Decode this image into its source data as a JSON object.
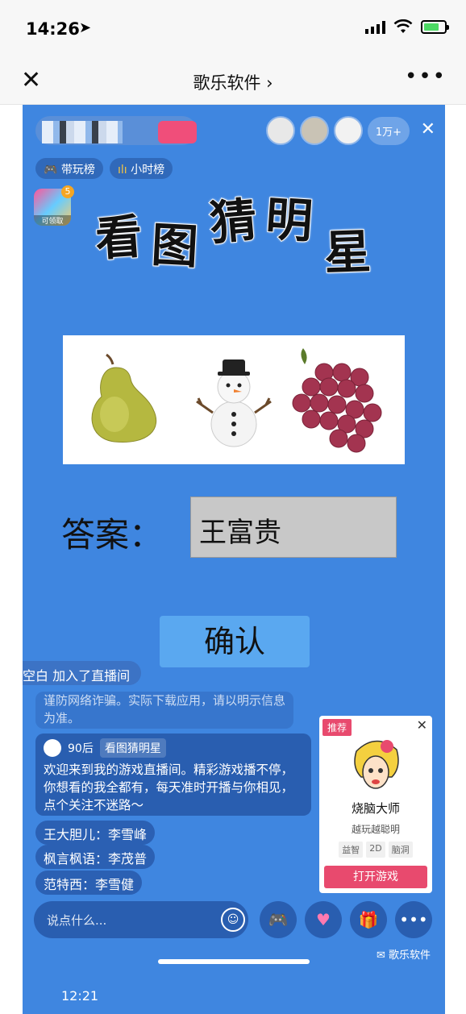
{
  "status_bar": {
    "time": "14:26",
    "location_arrow": "➤"
  },
  "nav": {
    "close_glyph": "✕",
    "title": "歌乐软件 ›",
    "more_glyph": "•••"
  },
  "live": {
    "viewer_count": "1万+",
    "close_glyph": "✕",
    "rank_pills": [
      "带玩榜",
      "小时榜"
    ],
    "badge": {
      "count": "5",
      "label": "可领取"
    },
    "title_chars": [
      "看",
      "图",
      "猜",
      "明",
      "星"
    ],
    "quiz_emojis": [
      "🍐",
      "⛄",
      "🍇"
    ],
    "answer_label": "答案：",
    "answer_value": "王富贵",
    "confirm_label": "确认"
  },
  "chat": {
    "joined": "空白 加入了直播间",
    "notice": "谨防网络诈骗。实际下载应用，请以明示信息为准。",
    "host_card": {
      "level": "90后",
      "tag": "看图猜明星",
      "message": "欢迎来到我的游戏直播间。精彩游戏播不停，你想看的我全都有，每天准时开播与你相见，点个关注不迷路～"
    },
    "comments": [
      "王大胆儿：李雪峰",
      "枫言枫语：李茂普",
      "范特西：李雪健"
    ]
  },
  "ad": {
    "recommend": "推荐",
    "close_glyph": "✕",
    "name": "烧脑大师",
    "slogan": "越玩越聪明",
    "tags": [
      "益智",
      "2D",
      "脑洞"
    ],
    "open_button": "打开游戏"
  },
  "input": {
    "placeholder": "说点什么..."
  },
  "watermark": "歌乐软件",
  "nested_time": "12:21",
  "colors": {
    "stream_bg": "#3f86e0",
    "accent_pink": "#e84a6e",
    "confirm_blue": "#5aa8f0"
  }
}
